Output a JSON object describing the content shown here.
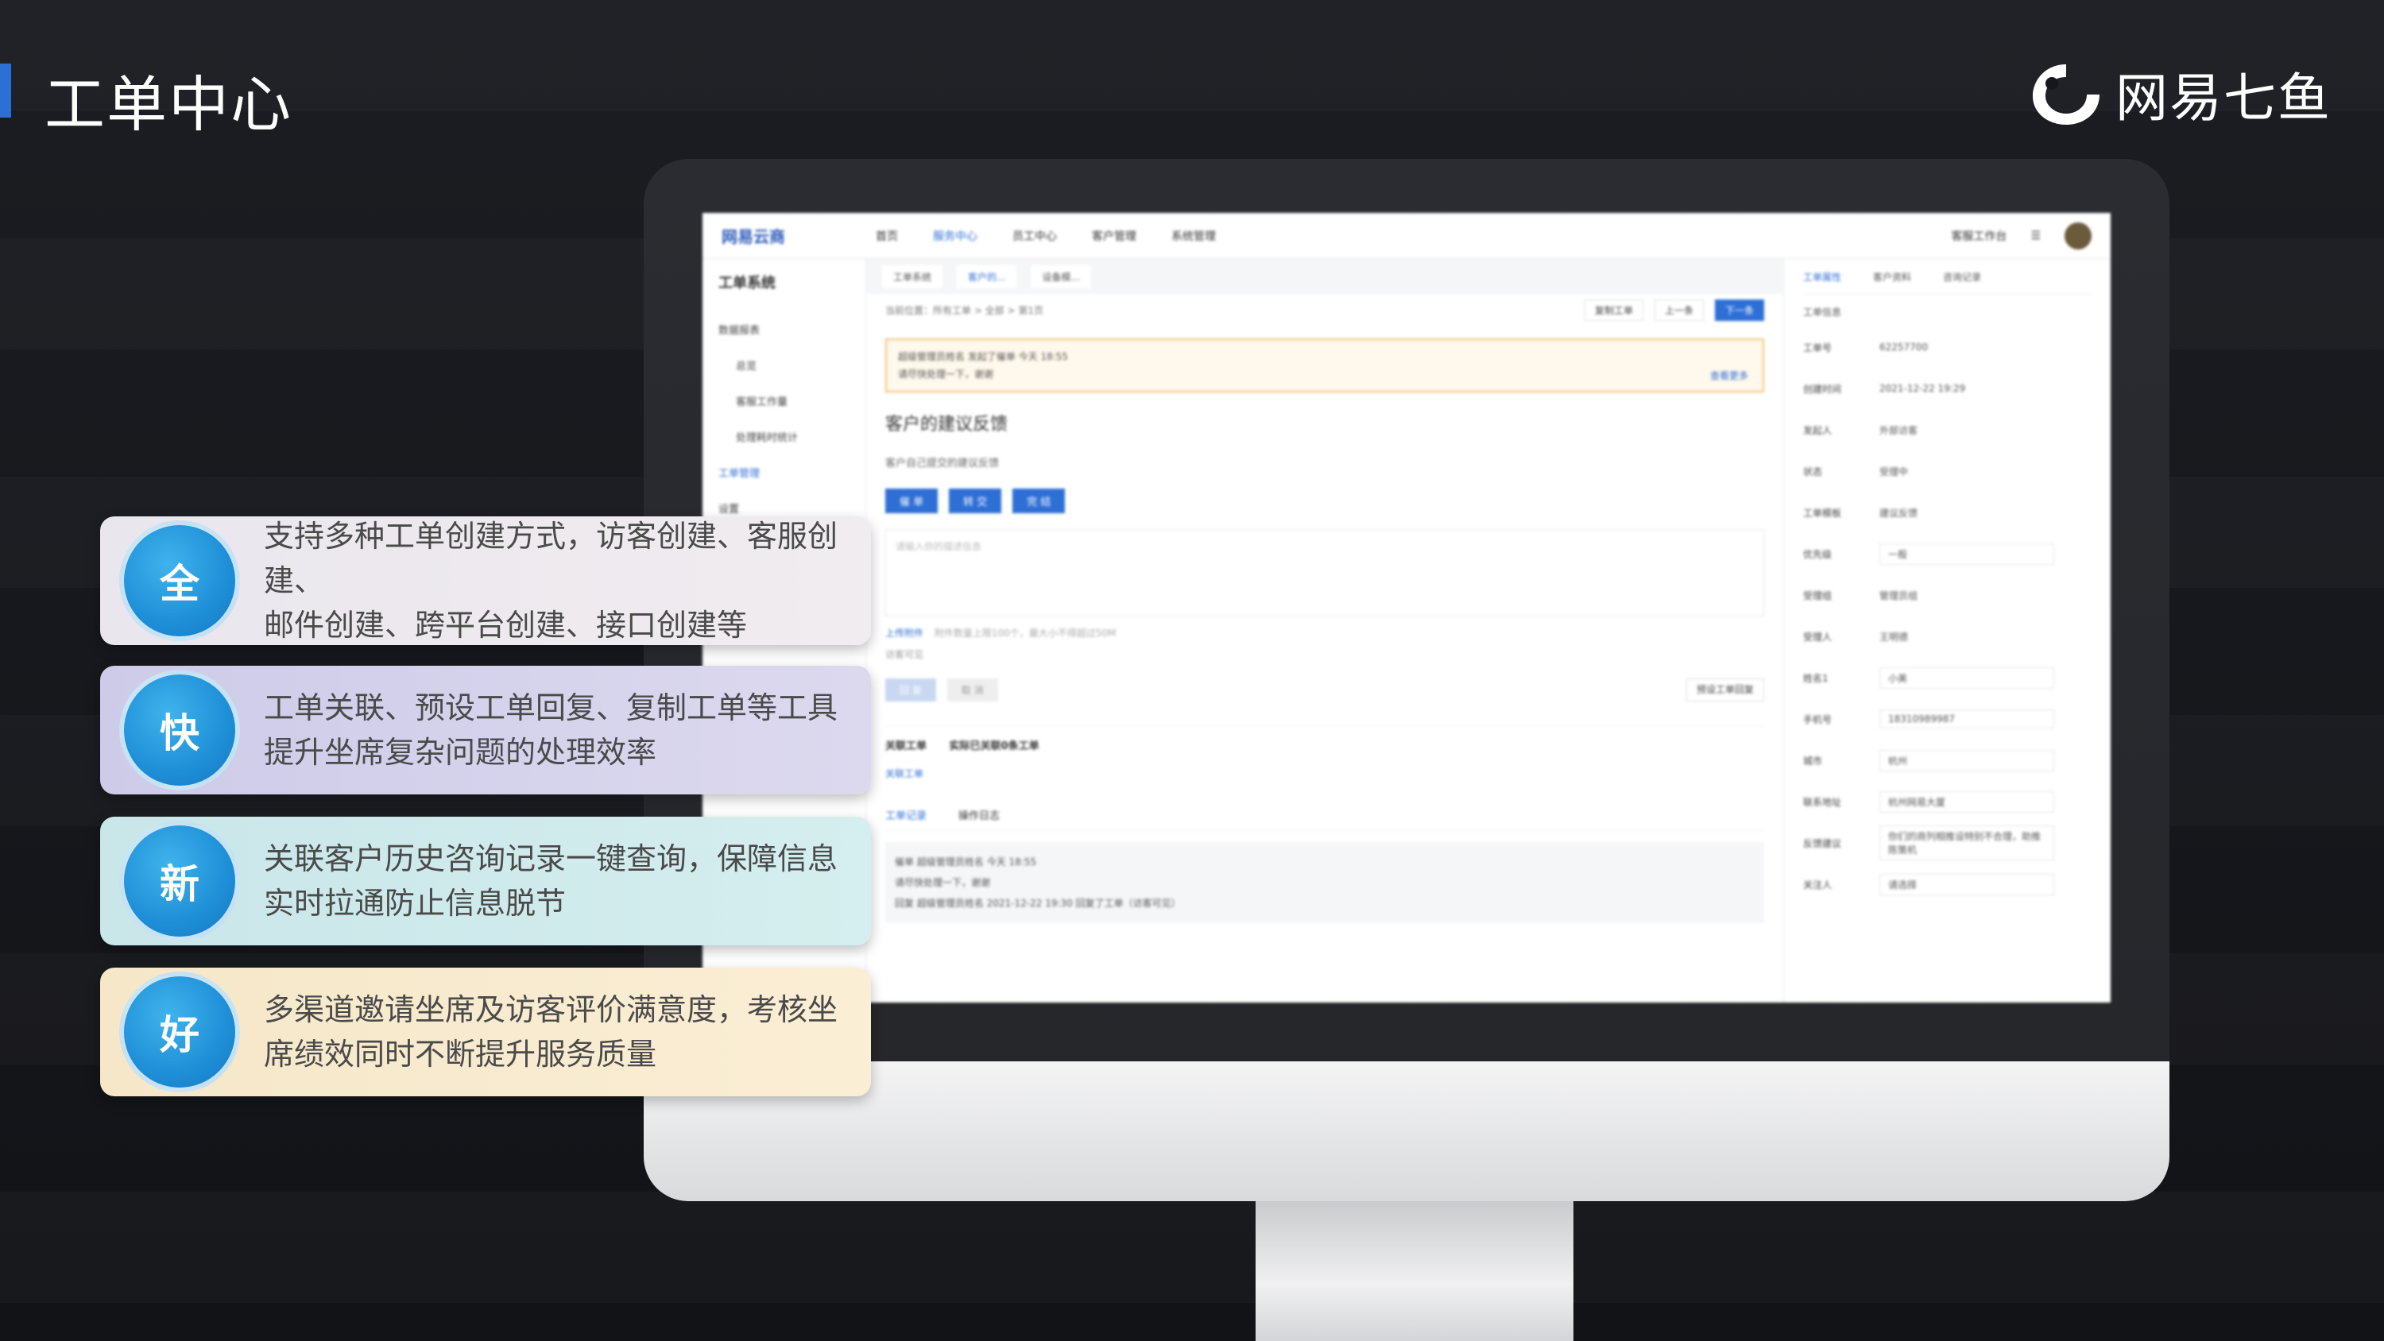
{
  "page": {
    "title": "工单中心"
  },
  "brand": {
    "name": "网易七鱼",
    "accent": "#2e6fd6"
  },
  "features": [
    {
      "badge": "全",
      "line1": "支持多种工单创建方式，访客创建、客服创建、",
      "line2": "邮件创建、跨平台创建、接口创建等",
      "bg": "#ece8ef"
    },
    {
      "badge": "快",
      "line1": "工单关联、预设工单回复、复制工单等工具",
      "line2": "提升坐席复杂问题的处理效率",
      "bg": "#d4d2ec"
    },
    {
      "badge": "新",
      "line1": "关联客户历史咨询记录一键查询，保障信息",
      "line2": "实时拉通防止信息脱节",
      "bg": "#cfeaeb"
    },
    {
      "badge": "好",
      "line1": "多渠道邀请坐席及访客评价满意度，考核坐",
      "line2": "席绩效同时不断提升服务质量",
      "bg": "#f8eacf"
    }
  ],
  "screen": {
    "logo": "网易云商",
    "nav": [
      "首页",
      "服务中心",
      "员工中心",
      "客户管理",
      "系统管理"
    ],
    "top_right": "客服工作台",
    "sidebar": {
      "title": "工单系统",
      "items": [
        "数据报表",
        "总览",
        "客服工作量",
        "处理耗时统计",
        "工单管理",
        "设置"
      ]
    },
    "tabs": [
      "工单系统",
      "客户的...",
      "设备模..."
    ],
    "breadcrumb": "当前位置：所有工单 > 全部 > 第1页",
    "crumb_actions": {
      "copy": "复制工单",
      "prev": "上一条",
      "next": "下一条"
    },
    "notice": {
      "line1": "超级管理员姓名 发起了催单 今天 18:55",
      "line2": "请尽快处理一下，谢谢",
      "more": "查看更多"
    },
    "ticket_title": "客户的建议反馈",
    "ticket_desc": "客户自己提交的建议反馈",
    "actions": [
      "催 单",
      "转 交",
      "完 结"
    ],
    "reply_placeholder": "请输入你的描述信息",
    "upload": "上传附件",
    "upload_hint": "附件数量上限100个，最大小不得超过50M",
    "visitor_visible": "访客可见",
    "reply_btns": [
      "回 复",
      "取 消"
    ],
    "preset_reply": "预设工单回复",
    "related": {
      "title": "关联工单",
      "sub": "实际已关联0条工单",
      "link": "关联工单"
    },
    "record_tabs": [
      "工单记录",
      "操作日志"
    ],
    "records": [
      {
        "tag": "催单",
        "who": "超级管理员姓名",
        "time": "今天 18:55",
        "text": "请尽快处理一下，谢谢"
      },
      {
        "tag": "回复",
        "who": "超级管理员姓名",
        "time": "2021-12-22 19:30",
        "text": "回复了工单（访客可见）"
      }
    ],
    "right": {
      "tabs": [
        "工单属性",
        "客户资料",
        "咨询记录"
      ],
      "section": "工单信息",
      "fields": [
        {
          "label": "工单号",
          "value": "62257700"
        },
        {
          "label": "创建时间",
          "value": "2021-12-22 19:29"
        },
        {
          "label": "发起人",
          "value": "外部访客"
        },
        {
          "label": "状态",
          "value": "受理中"
        },
        {
          "label": "工单模板",
          "value": "建议反馈"
        },
        {
          "label": "优先级",
          "value": "一般"
        },
        {
          "label": "受理组",
          "value": "管理员组"
        },
        {
          "label": "受理人",
          "value": "王明德"
        },
        {
          "label": "姓名1",
          "value": "小美"
        },
        {
          "label": "手机号",
          "value": "18310989987"
        },
        {
          "label": "城市",
          "value": "杭州"
        },
        {
          "label": "联系地址",
          "value": "杭州网易大厦"
        },
        {
          "label": "反馈建议",
          "value": "你们的商列相推设特别不合理，助推陈策机"
        },
        {
          "label": "关注人",
          "value": "请选择"
        }
      ]
    }
  }
}
